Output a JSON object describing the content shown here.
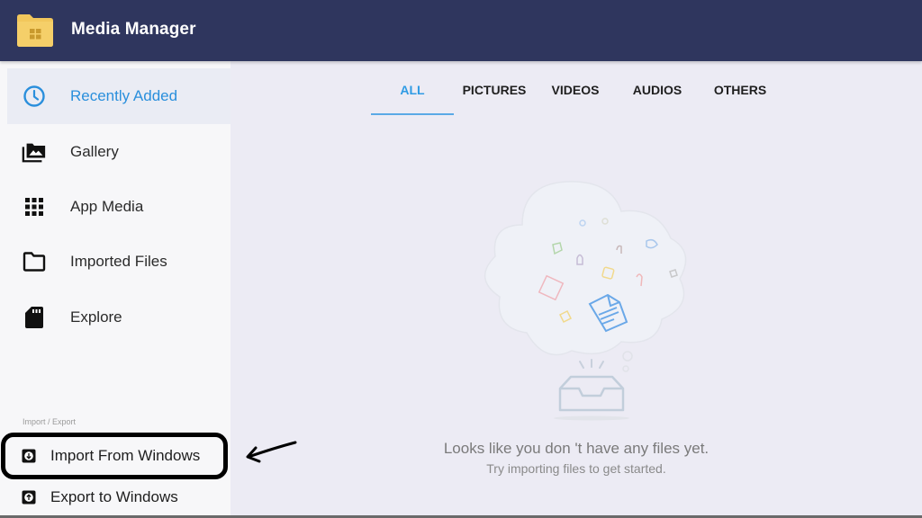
{
  "header": {
    "title": "Media Manager",
    "logo_icon": "folder-windows-icon",
    "background_color": "#2f365e"
  },
  "sidebar": {
    "items": [
      {
        "label": "Recently Added",
        "icon": "clock-icon",
        "active": true
      },
      {
        "label": "Gallery",
        "icon": "photo-library-icon",
        "active": false
      },
      {
        "label": "App Media",
        "icon": "grid-apps-icon",
        "active": false
      },
      {
        "label": "Imported Files",
        "icon": "folder-icon",
        "active": false
      },
      {
        "label": "Explore",
        "icon": "sd-card-icon",
        "active": false
      }
    ],
    "section_label": "Import / Export",
    "import_label": "Import From Windows",
    "export_label": "Export to Windows",
    "accent_color": "#2a8fdc"
  },
  "tabs": [
    {
      "label": "ALL",
      "active": true
    },
    {
      "label": "PICTURES",
      "active": false
    },
    {
      "label": "VIDEOS",
      "active": false
    },
    {
      "label": "AUDIOS",
      "active": false
    },
    {
      "label": "OTHERS",
      "active": false
    }
  ],
  "empty_state": {
    "title": "Looks like you don 't have any files yet.",
    "subtitle": "Try importing files to get started.",
    "illustration": "empty-inbox-cloud-illustration"
  },
  "annotation": {
    "highlighted_item": "Import From Windows",
    "arrow": "pointing-left-arrow"
  }
}
